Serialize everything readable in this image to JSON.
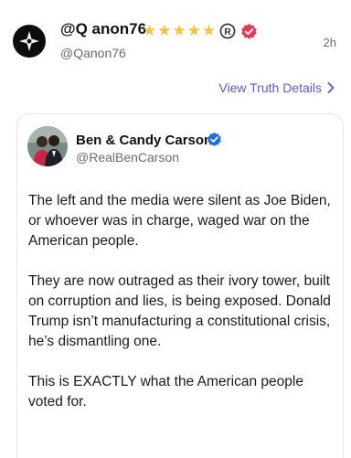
{
  "post": {
    "author_name": "@Q anon76",
    "badge_stars": [
      "★",
      "★",
      "★",
      "★",
      "★"
    ],
    "registered_mark": "R",
    "handle": "@Qanon76",
    "time": "2h",
    "view_details_label": "View Truth Details",
    "avatar_icon": "cross-logo-icon"
  },
  "quoted": {
    "name": "Ben & Candy Carson",
    "handle": "@RealBenCarson",
    "paragraphs": [
      "The left and the media were silent as Joe Biden, or whoever was in charge, waged war on the American people.",
      "They are now outraged as their ivory tower, built on corruption and lies, is being exposed. Donald Trump isn’t manufacturing a constitutional crisis, he’s dismantling one.",
      "This is EXACTLY what the American people voted for."
    ]
  },
  "colors": {
    "accent": "#5b57d6",
    "verified_red": "#e5385b",
    "verified_blue": "#1d6fe0",
    "star": "#f5c43a",
    "muted": "#6b6b73"
  }
}
